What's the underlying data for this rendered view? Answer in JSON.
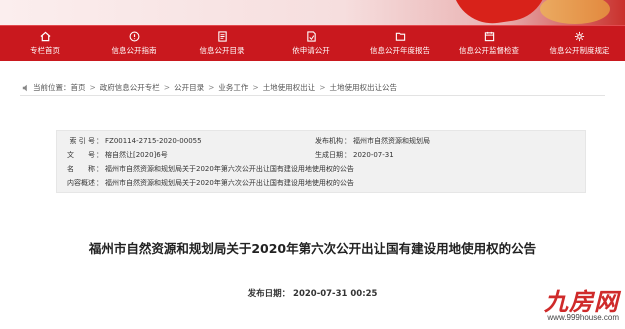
{
  "nav": {
    "items": [
      {
        "label": "专栏首页",
        "icon": "home-icon"
      },
      {
        "label": "信息公开指南",
        "icon": "guide-icon"
      },
      {
        "label": "信息公开目录",
        "icon": "catalog-icon"
      },
      {
        "label": "依申请公开",
        "icon": "apply-icon"
      },
      {
        "label": "信息公开年度报告",
        "icon": "report-icon"
      },
      {
        "label": "信息公开监督检查",
        "icon": "inspection-icon"
      },
      {
        "label": "信息公开制度规定",
        "icon": "regulation-icon"
      }
    ]
  },
  "breadcrumb": {
    "prefix": "当前位置：",
    "items": [
      "首页",
      "政府信息公开专栏",
      "公开目录",
      "业务工作",
      "土地使用权出让",
      "土地使用权出让公告"
    ],
    "separator": ">"
  },
  "info": {
    "index_label": "索 引 号",
    "index_value": "FZ00114-2715-2020-00055",
    "org_label": "发布机构",
    "org_value": "福州市自然资源和规划局",
    "doc_label": "文　　号",
    "doc_value": "榕自然让[2020]6号",
    "date_label": "生成日期",
    "date_value": "2020-07-31",
    "name_label": "名　　称",
    "name_value": "福州市自然资源和规划局关于2020年第六次公开出让国有建设用地使用权的公告",
    "summary_label": "内容概述",
    "summary_value": "福州市自然资源和规划局关于2020年第六次公开出让国有建设用地使用权的公告"
  },
  "article": {
    "title": "福州市自然资源和规划局关于2020年第六次公开出让国有建设用地使用权的公告",
    "pub_label": "发布日期：",
    "pub_value": "2020-07-31 00:25"
  },
  "watermark": {
    "logo": "九房网",
    "url": "www.999house.com"
  },
  "colors": {
    "nav_bg": "#c9181e",
    "info_bg": "#f1f1f1",
    "watermark": "#cf2a2a"
  }
}
